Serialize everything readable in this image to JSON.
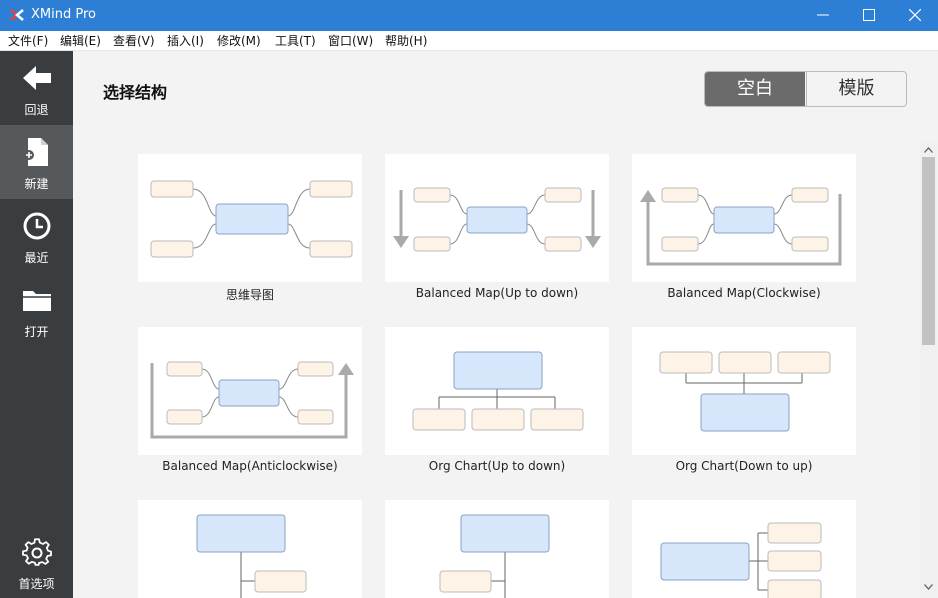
{
  "window": {
    "title": "XMind Pro"
  },
  "menu": [
    "文件(F)",
    "编辑(E)",
    "查看(V)",
    "插入(I)",
    "修改(M)",
    "工具(T)",
    "窗口(W)",
    "帮助(H)"
  ],
  "sidebar": {
    "items": [
      {
        "label": "回退",
        "icon": "back-arrow-icon"
      },
      {
        "label": "新建",
        "icon": "new-file-icon",
        "active": true
      },
      {
        "label": "最近",
        "icon": "clock-icon"
      },
      {
        "label": "打开",
        "icon": "folder-icon"
      }
    ],
    "settings_label": "首选项"
  },
  "main": {
    "title": "选择结构",
    "segment": {
      "blank": "空白",
      "template": "模版",
      "selected": "空白"
    },
    "templates": [
      "思维导图",
      "Balanced Map(Up to down)",
      "Balanced Map(Clockwise)",
      "Balanced Map(Anticlockwise)",
      "Org Chart(Up to down)",
      "Org Chart(Down to up)"
    ]
  },
  "colors": {
    "titlebar": "#2d7fd6",
    "sidebar": "#3a3d3f",
    "sidebar_active": "#55595c",
    "central_topic": "#d6e6fb",
    "sub_topic": "#fdf4e7",
    "segment_selected": "#6b6b6b"
  }
}
